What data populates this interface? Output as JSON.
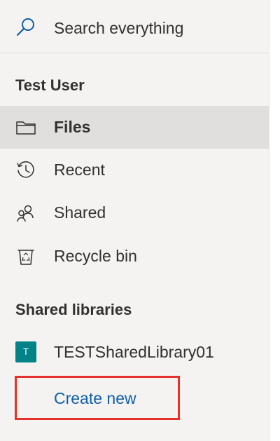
{
  "search": {
    "placeholder": "Search everything",
    "icon": "search-icon"
  },
  "user_section": {
    "title": "Test User",
    "items": [
      {
        "label": "Files",
        "icon": "folder-icon",
        "selected": true
      },
      {
        "label": "Recent",
        "icon": "history-icon",
        "selected": false
      },
      {
        "label": "Shared",
        "icon": "people-icon",
        "selected": false
      },
      {
        "label": "Recycle bin",
        "icon": "recycle-bin-icon",
        "selected": false
      }
    ]
  },
  "libraries_section": {
    "title": "Shared libraries",
    "items": [
      {
        "label": "TESTSharedLibrary01",
        "badge": "T",
        "badge_color": "#038387"
      }
    ],
    "create_new_label": "Create new"
  },
  "colors": {
    "nav_background": "#f4f3f2",
    "selected_background": "#e1dfdd",
    "link": "#0f5fa8",
    "highlight_border": "#e8302a"
  }
}
